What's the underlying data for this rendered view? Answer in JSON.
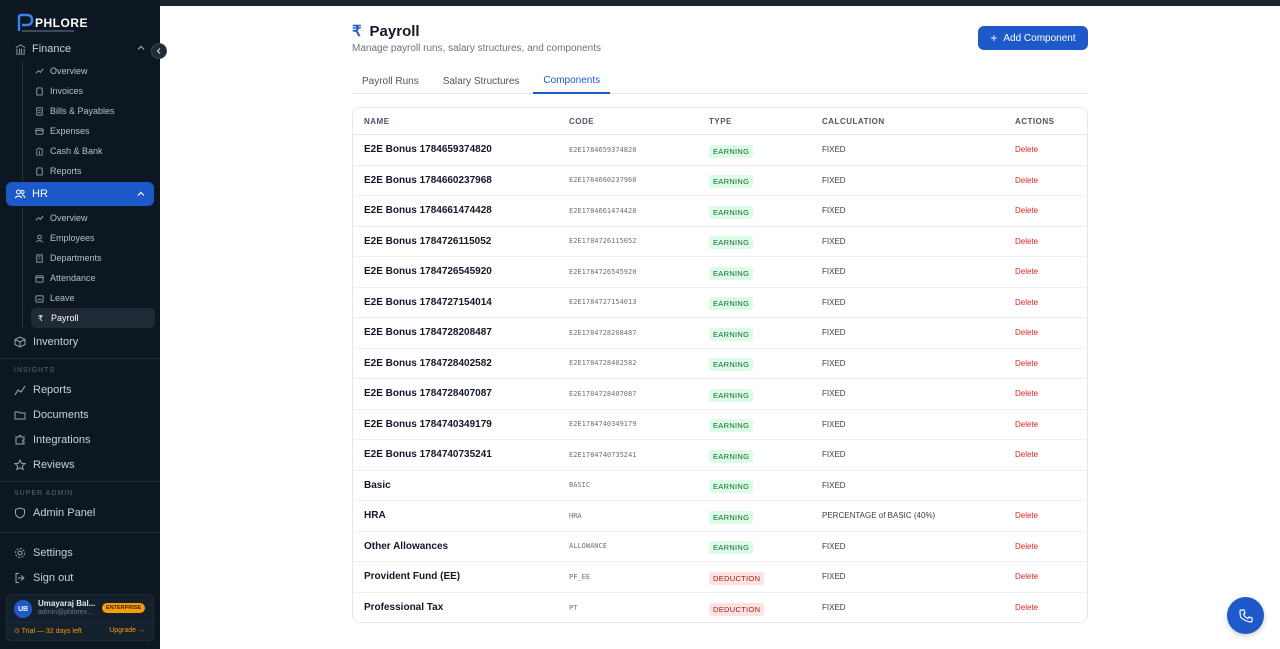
{
  "brand": {
    "logo_text": "PHLORE"
  },
  "sidebar": {
    "finance_label": "Finance",
    "finance_items": [
      {
        "label": "Overview",
        "icon": "trend-icon"
      },
      {
        "label": "Invoices",
        "icon": "file-icon"
      },
      {
        "label": "Bills & Payables",
        "icon": "receipt-icon"
      },
      {
        "label": "Expenses",
        "icon": "card-icon"
      },
      {
        "label": "Cash & Bank",
        "icon": "bank-icon"
      },
      {
        "label": "Reports",
        "icon": "file-icon"
      }
    ],
    "hr_label": "HR",
    "hr_items": [
      {
        "label": "Overview",
        "icon": "trend-icon"
      },
      {
        "label": "Employees",
        "icon": "user-icon"
      },
      {
        "label": "Departments",
        "icon": "building-icon"
      },
      {
        "label": "Attendance",
        "icon": "calendar-icon"
      },
      {
        "label": "Leave",
        "icon": "leave-icon"
      },
      {
        "label": "Payroll",
        "icon": "rupee-icon"
      }
    ],
    "inventory_label": "Inventory",
    "insights_label": "INSIGHTS",
    "insights_items": [
      {
        "label": "Reports",
        "icon": "chart-icon"
      },
      {
        "label": "Documents",
        "icon": "folder-icon"
      },
      {
        "label": "Integrations",
        "icon": "puzzle-icon"
      },
      {
        "label": "Reviews",
        "icon": "star-icon"
      }
    ],
    "super_admin_label": "SUPER ADMIN",
    "admin_panel_label": "Admin Panel",
    "settings_label": "Settings",
    "signout_label": "Sign out",
    "user": {
      "initials": "UB",
      "name": "Umayaraj Bal...",
      "email": "admin@phlorex...",
      "plan_badge": "ENTERPRISE",
      "trial_text": "⊙ Trial — 32 days left",
      "upgrade_text": "Upgrade →"
    }
  },
  "page": {
    "title": "Payroll",
    "subtitle": "Manage payroll runs, salary structures, and components",
    "add_button": "Add Component",
    "tabs": [
      "Payroll Runs",
      "Salary Structures",
      "Components"
    ],
    "active_tab": "Components"
  },
  "table": {
    "headers": [
      "NAME",
      "CODE",
      "TYPE",
      "CALCULATION",
      "ACTIONS"
    ],
    "rows": [
      {
        "name": "E2E Bonus 1784659374820",
        "code": "E2E1784659374820",
        "type": "EARNING",
        "calc": "FIXED",
        "action": "Delete"
      },
      {
        "name": "E2E Bonus 1784660237968",
        "code": "E2E1784660237968",
        "type": "EARNING",
        "calc": "FIXED",
        "action": "Delete"
      },
      {
        "name": "E2E Bonus 1784661474428",
        "code": "E2E1784661474428",
        "type": "EARNING",
        "calc": "FIXED",
        "action": "Delete"
      },
      {
        "name": "E2E Bonus 1784726115052",
        "code": "E2E1784726115052",
        "type": "EARNING",
        "calc": "FIXED",
        "action": "Delete"
      },
      {
        "name": "E2E Bonus 1784726545920",
        "code": "E2E1784726545920",
        "type": "EARNING",
        "calc": "FIXED",
        "action": "Delete"
      },
      {
        "name": "E2E Bonus 1784727154014",
        "code": "E2E1784727154013",
        "type": "EARNING",
        "calc": "FIXED",
        "action": "Delete"
      },
      {
        "name": "E2E Bonus 1784728208487",
        "code": "E2E1784728208487",
        "type": "EARNING",
        "calc": "FIXED",
        "action": "Delete"
      },
      {
        "name": "E2E Bonus 1784728402582",
        "code": "E2E1784728402582",
        "type": "EARNING",
        "calc": "FIXED",
        "action": "Delete"
      },
      {
        "name": "E2E Bonus 1784728407087",
        "code": "E2E1784728407087",
        "type": "EARNING",
        "calc": "FIXED",
        "action": "Delete"
      },
      {
        "name": "E2E Bonus 1784740349179",
        "code": "E2E1784740349179",
        "type": "EARNING",
        "calc": "FIXED",
        "action": "Delete"
      },
      {
        "name": "E2E Bonus 1784740735241",
        "code": "E2E1784740735241",
        "type": "EARNING",
        "calc": "FIXED",
        "action": "Delete"
      },
      {
        "name": "Basic",
        "code": "BASIC",
        "type": "EARNING",
        "calc": "FIXED",
        "action": ""
      },
      {
        "name": "HRA",
        "code": "HRA",
        "type": "EARNING",
        "calc": "PERCENTAGE of BASIC (40%)",
        "action": "Delete"
      },
      {
        "name": "Other Allowances",
        "code": "ALLOWANCE",
        "type": "EARNING",
        "calc": "FIXED",
        "action": "Delete"
      },
      {
        "name": "Provident Fund (EE)",
        "code": "PF_EE",
        "type": "DEDUCTION",
        "calc": "FIXED",
        "action": "Delete"
      },
      {
        "name": "Professional Tax",
        "code": "PT",
        "type": "DEDUCTION",
        "calc": "FIXED",
        "action": "Delete"
      }
    ]
  },
  "colors": {
    "accent": "#1d59c9",
    "sidebar_bg": "#0d1722",
    "earning_bg": "#dcfce7",
    "deduction_bg": "#fee2e2",
    "delete_text": "#dc2626"
  }
}
